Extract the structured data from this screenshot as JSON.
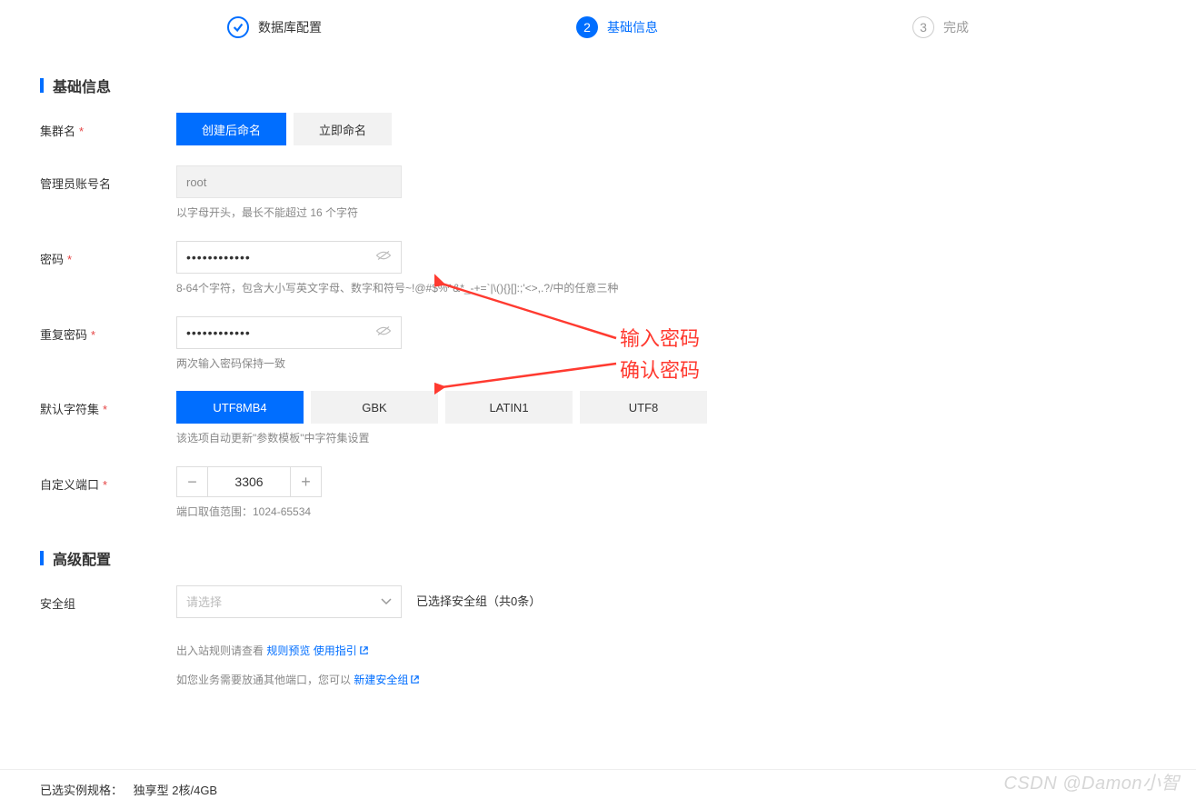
{
  "steps": {
    "s1": {
      "label": "数据库配置"
    },
    "s2": {
      "num": "2",
      "label": "基础信息"
    },
    "s3": {
      "num": "3",
      "label": "完成"
    }
  },
  "sections": {
    "basic": "基础信息",
    "advanced": "高级配置"
  },
  "labels": {
    "cluster_name": "集群名",
    "admin_account": "管理员账号名",
    "password": "密码",
    "repeat_password": "重复密码",
    "charset": "默认字符集",
    "custom_port": "自定义端口",
    "security_group": "安全组"
  },
  "cluster_name": {
    "tab_after": "创建后命名",
    "tab_now": "立即命名"
  },
  "admin_account": {
    "value": "root",
    "hint": "以字母开头，最长不能超过 16 个字符"
  },
  "password": {
    "value": "••••••••••••",
    "hint": "8-64个字符，包含大小写英文字母、数字和符号~!@#$%^&*_-+=`|\\(){}[]:;'<>,.?/中的任意三种"
  },
  "repeat_password": {
    "value": "••••••••••••",
    "hint": "两次输入密码保持一致"
  },
  "charset": {
    "opt1": "UTF8MB4",
    "opt2": "GBK",
    "opt3": "LATIN1",
    "opt4": "UTF8",
    "hint": "该选项自动更新\"参数模板\"中字符集设置"
  },
  "custom_port": {
    "minus": "−",
    "plus": "+",
    "value": "3306",
    "hint": "端口取值范围：1024-65534"
  },
  "security_group": {
    "placeholder": "请选择",
    "selected_text": "已选择安全组（共0条）",
    "rules_prefix": "出入站规则请查看 ",
    "rules_link1": "规则预览",
    "rules_link2": "使用指引",
    "ports_prefix": "如您业务需要放通其他端口，您可以 ",
    "ports_link": "新建安全组"
  },
  "anno": {
    "line1": "输入密码",
    "line2": "确认密码"
  },
  "footer": {
    "label": "已选实例规格：",
    "value": "独享型 2核/4GB"
  },
  "watermark": "CSDN @Damon小智"
}
